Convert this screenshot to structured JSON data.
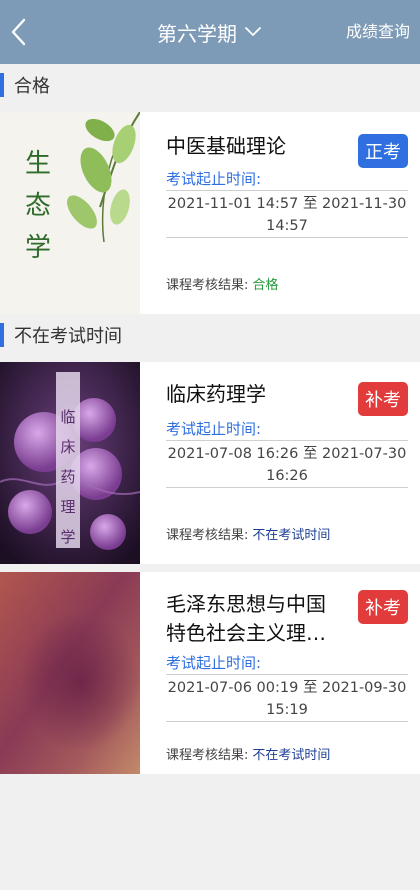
{
  "header": {
    "term": "第六学期",
    "query": "成绩查询"
  },
  "sections": [
    {
      "title": "合格"
    },
    {
      "title": "不在考试时间"
    }
  ],
  "courses": [
    {
      "thumb_title": "生态学",
      "name": "中医基础理论",
      "badge": "正考",
      "period_label": "考试起止时间:",
      "period_line1": "2021-11-01 14:57 至 2021-11-30",
      "period_line2": "14:57",
      "result_label": "课程考核结果:",
      "result_value": "合格"
    },
    {
      "thumb_title": "临床药理学",
      "name": "临床药理学",
      "badge": "补考",
      "period_label": "考试起止时间:",
      "period_line1": "2021-07-08 16:26 至 2021-07-30",
      "period_line2": "16:26",
      "result_label": "课程考核结果:",
      "result_value": "不在考试时间"
    },
    {
      "name_line1": "毛泽东思想与中国",
      "name_line2": "特色社会主义理…",
      "badge": "补考",
      "period_label": "考试起止时间:",
      "period_line1": "2021-07-06 00:19 至 2021-09-30",
      "period_line2": "15:19",
      "result_label": "课程考核结果:",
      "result_value": "不在考试时间"
    }
  ],
  "colors": {
    "header_bg": "#7d9bb6",
    "accent_blue": "#2f6fe0",
    "badge_red": "#e23b3b",
    "pass_green": "#239a3a",
    "status_navy": "#1d3f94"
  }
}
